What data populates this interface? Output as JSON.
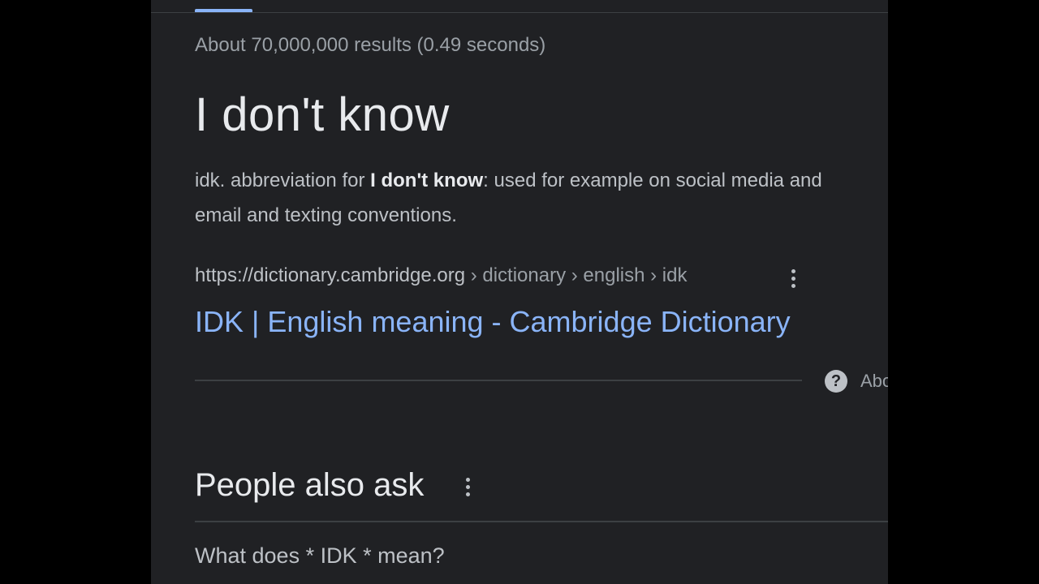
{
  "results": {
    "stats": "About 70,000,000 results (0.49 seconds)"
  },
  "featured_snippet": {
    "title": "I don't know",
    "description_prefix": "idk. abbreviation for ",
    "description_bold": "I don't know",
    "description_suffix": ": used for example on social media and",
    "description_line2": "email and texting conventions.",
    "cite_domain": "https://dictionary.cambridge.org",
    "cite_path": " › dictionary › english › idk",
    "link_title": "IDK | English meaning - Cambridge Dictionary",
    "about_label": "About"
  },
  "people_also_ask": {
    "title": "People also ask",
    "questions": [
      "What does * IDK * mean?"
    ]
  },
  "colors": {
    "background": "#202124",
    "link": "#8ab4f8",
    "text_primary": "#e8eaed",
    "text_secondary": "#bdc1c6"
  },
  "icons": {
    "more_options": "kebab-menu-icon",
    "help": "question-mark-icon"
  }
}
